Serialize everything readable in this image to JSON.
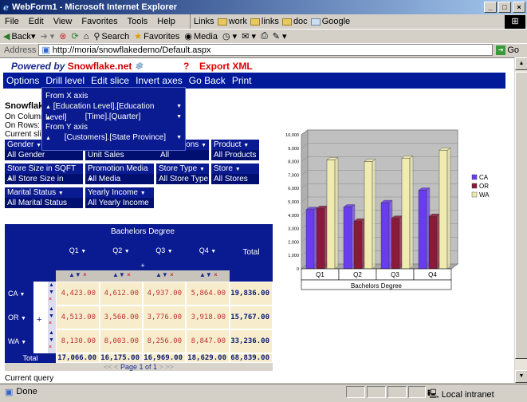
{
  "window": {
    "title": "WebForm1 - Microsoft Internet Explorer",
    "min": "_",
    "max": "□",
    "close": "×"
  },
  "menu": [
    "File",
    "Edit",
    "View",
    "Favorites",
    "Tools",
    "Help"
  ],
  "links": {
    "label": "Links",
    "items": [
      "work",
      "links",
      "doc",
      "Google"
    ]
  },
  "toolbar": {
    "back": "Back",
    "search": "Search",
    "favorites": "Favorites",
    "media": "Media"
  },
  "address": {
    "label": "Address",
    "url": "http://moria/snowflakedemo/Default.aspx",
    "go": "Go"
  },
  "header": {
    "powered_by": "Powered by",
    "brand": "Snowflake.net",
    "help": "?",
    "export": "Export XML"
  },
  "nav": [
    "Options",
    "Drill level",
    "Edit slice",
    "Invert axes",
    "Go Back",
    "Print"
  ],
  "popup": {
    "from_x": "From X axis",
    "x_items": [
      "[Education Level].[Education Level]",
      "[Time].[Quarter]"
    ],
    "from_y": "From Y axis",
    "y_items": [
      "[Customers].[State Province]"
    ]
  },
  "info": {
    "title": "Snowflak",
    "on_columns": "On Column",
    "on_rows": "On Rows:",
    "current_slice": "Current slic"
  },
  "dims": [
    {
      "head": "Gender",
      "value": "All Gender"
    },
    {
      "head": "",
      "value": "Unit Sales"
    },
    {
      "head": "ons",
      "value": "All Promotions"
    },
    {
      "head": "Product",
      "value": "All Products"
    },
    {
      "head": "Store Size in SQFT",
      "value": "All Store Size in SQFT"
    },
    {
      "head": "Promotion Media",
      "value": "All Media"
    },
    {
      "head": "Store Type",
      "value": "All Store Type"
    },
    {
      "head": "Store",
      "value": "All Stores"
    },
    {
      "head": "Marital Status",
      "value": "All Marital Status"
    },
    {
      "head": "Yearly Income",
      "value": "All Yearly Income"
    }
  ],
  "pivot": {
    "column_group": "Bachelors Degree",
    "plus": "+",
    "quarters": [
      "Q1",
      "Q2",
      "Q3",
      "Q4"
    ],
    "total_label": "Total",
    "rows": [
      {
        "name": "CA",
        "values": [
          "4,423.00",
          "4,612.00",
          "4,937.00",
          "5,864.00"
        ],
        "total": "19,836.00"
      },
      {
        "name": "OR",
        "values": [
          "4,513.00",
          "3,560.00",
          "3,776.00",
          "3,918.00"
        ],
        "total": "15,767.00"
      },
      {
        "name": "WA",
        "values": [
          "8,130.00",
          "8,003.00",
          "8,256.00",
          "8,847.00"
        ],
        "total": "33,236.00"
      }
    ],
    "totals": [
      "17,066.00",
      "16,175.00",
      "16,969.00",
      "18,629.00"
    ],
    "grand_total": "68,839.00",
    "row_plus": "+",
    "pager": "Page 1 of 1"
  },
  "current_query": "Current query",
  "chart_data": {
    "type": "bar",
    "categories": [
      "Q1",
      "Q2",
      "Q3",
      "Q4"
    ],
    "xlabel": "Bachelors Degree",
    "ylim": [
      0,
      10000
    ],
    "yticks": [
      "0",
      "1,000",
      "2,000",
      "3,000",
      "4,000",
      "5,000",
      "6,000",
      "7,000",
      "8,000",
      "9,000",
      "10,000"
    ],
    "series": [
      {
        "name": "CA",
        "values": [
          4423,
          4612,
          4937,
          5864
        ],
        "color": "#6a3cf0"
      },
      {
        "name": "OR",
        "values": [
          4513,
          3560,
          3776,
          3918
        ],
        "color": "#8a1a3a"
      },
      {
        "name": "WA",
        "values": [
          8130,
          8003,
          8256,
          8847
        ],
        "color": "#f0ecb0"
      }
    ]
  },
  "status": {
    "text": "Done",
    "zone": "Local intranet"
  }
}
